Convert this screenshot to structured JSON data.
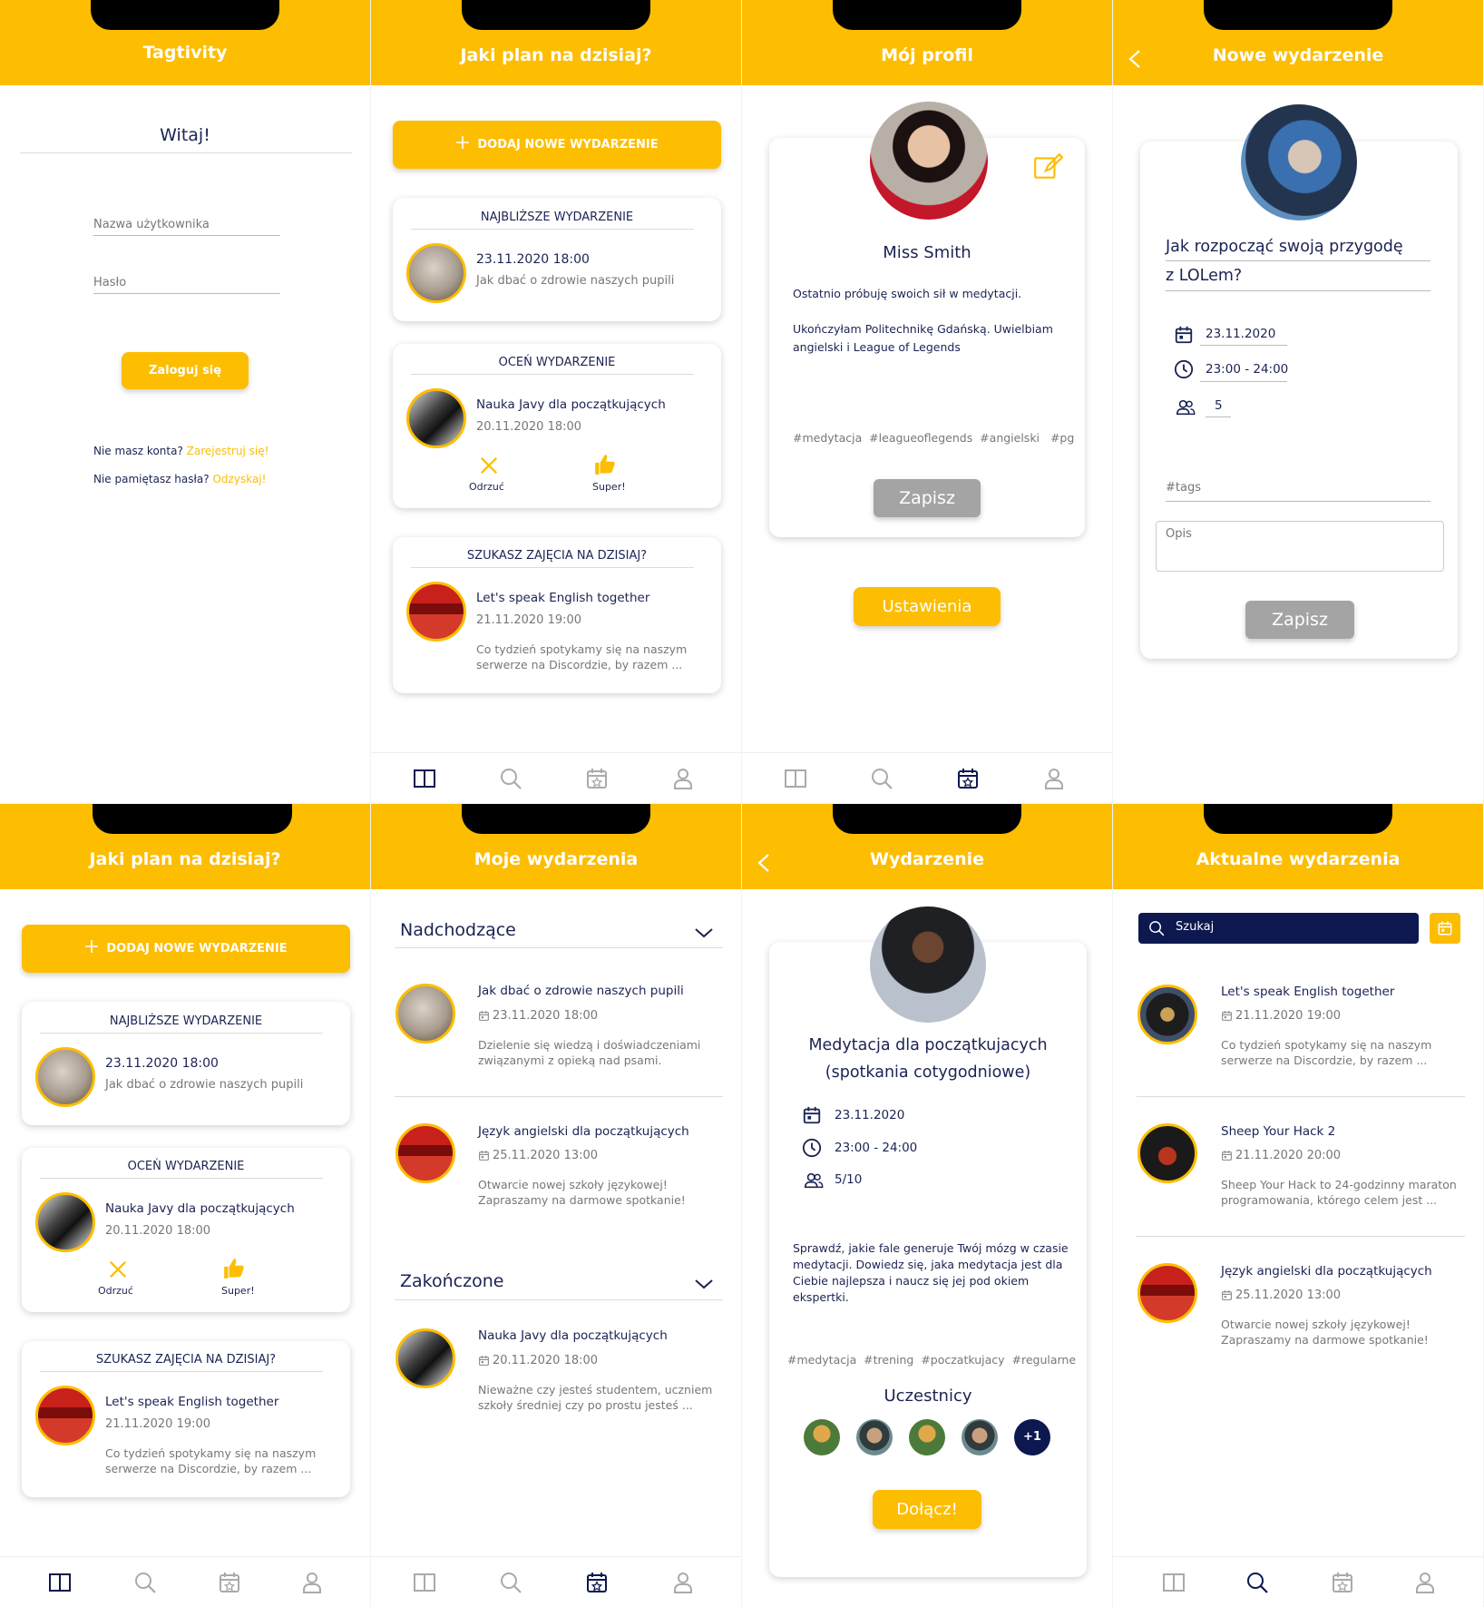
{
  "colors": {
    "accent": "#fdbd00",
    "navy": "#0d1850",
    "grey_button": "#a4a4a4"
  },
  "login": {
    "title": "Tagtivity",
    "welcome": "Witaj!",
    "username_placeholder": "Nazwa użytkownika",
    "password_placeholder": "Hasło",
    "login_button": "Zaloguj się",
    "no_account": "Nie masz konta?",
    "register": "Zarejestruj się!",
    "forgot": "Nie pamiętasz hasła?",
    "recover": "Odzyskaj!"
  },
  "home": {
    "title": "Jaki plan na dzisiaj?",
    "add_button": "DODAJ NOWE WYDARZENIE",
    "nearest": {
      "heading": "NAJBLIŻSZE WYDARZENIE",
      "date": "23.11.2020 18:00",
      "name": "Jak dbać o zdrowie naszych pupili"
    },
    "rate": {
      "heading": "OCEŃ WYDARZENIE",
      "name": "Nauka Javy dla początkujących",
      "date": "20.11.2020 18:00",
      "reject": "Odrzuć",
      "super": "Super!"
    },
    "looking": {
      "heading": "SZUKASZ ZAJĘCIA NA DZISIAJ?",
      "name": "Let's speak English together",
      "date": "21.11.2020 19:00",
      "desc1": "Co tydzień spotykamy się na naszym",
      "desc2": "serwerze na Discordzie, by razem ..."
    }
  },
  "profile": {
    "title": "Mój profil",
    "name": "Miss Smith",
    "bio1": "Ostatnio próbuję swoich sił w medytacji.",
    "bio2": "Ukończyłam Politechnikę Gdańską. Uwielbiam",
    "bio3": "angielski i League of Legends",
    "tags": "#medytacja  #leagueoflegends  #angielski   #pg",
    "save": "Zapisz",
    "settings": "Ustawienia"
  },
  "new_event": {
    "title": "Nowe wydarzenie",
    "name1": "Jak rozpocząć swoją przygodę",
    "name2": "z LOLem?",
    "date": "23.11.2020",
    "time": "23:00 - 24:00",
    "people": "5",
    "tags_placeholder": "#tags",
    "desc_placeholder": "Opis",
    "save": "Zapisz"
  },
  "my_events": {
    "title": "Moje wydarzenia",
    "upcoming": "Nadchodzące",
    "finished": "Zakończone",
    "items": [
      {
        "name": "Jak dbać o zdrowie naszych pupili",
        "date": "23.11.2020 18:00",
        "d1": "Dzielenie się wiedzą i doświadczeniami",
        "d2": "związanymi z opieką nad psami."
      },
      {
        "name": "Język angielski dla początkujących",
        "date": "25.11.2020 13:00",
        "d1": "Otwarcie nowej szkoły językowej!",
        "d2": "Zapraszamy na darmowe spotkanie!"
      },
      {
        "name": "Nauka Javy dla początkujących",
        "date": "20.11.2020 18:00",
        "d1": "Nieważne czy jesteś studentem, uczniem",
        "d2": "szkoły średniej czy po prostu jesteś ..."
      }
    ]
  },
  "event": {
    "title": "Wydarzenie",
    "name1": "Medytacja dla początkujacych",
    "name2": "(spotkania cotygodniowe)",
    "date": "23.11.2020",
    "time": "23:00 - 24:00",
    "people": "5/10",
    "d1": "Sprawdź, jakie fale generuje Twój mózg w czasie",
    "d2": "medytacji. Dowiedz się, jaka medytacja jest dla",
    "d3": "Ciebie najlepsza i naucz się jej pod okiem",
    "d4": "ekspertki.",
    "tags": "#medytacja  #trening  #poczatkujacy  #regularne",
    "participants": "Uczestnicy",
    "more": "+1",
    "join": "Dołącz!"
  },
  "current": {
    "title": "Aktualne wydarzenia",
    "search_placeholder": "Szukaj",
    "items": [
      {
        "name": "Let's speak English together",
        "date": "21.11.2020 19:00",
        "d1": "Co tydzień spotykamy się na naszym",
        "d2": "serwerze na Discordzie, by razem ..."
      },
      {
        "name": "Sheep Your Hack 2",
        "date": "21.11.2020 20:00",
        "d1": "Sheep Your Hack to 24-godzinny maraton",
        "d2": "programowania, którego celem jest ..."
      },
      {
        "name": "Język angielski dla początkujących",
        "date": "25.11.2020 13:00",
        "d1": "Otwarcie nowej szkoły językowej!",
        "d2": "Zapraszamy na darmowe spotkanie!"
      }
    ]
  }
}
